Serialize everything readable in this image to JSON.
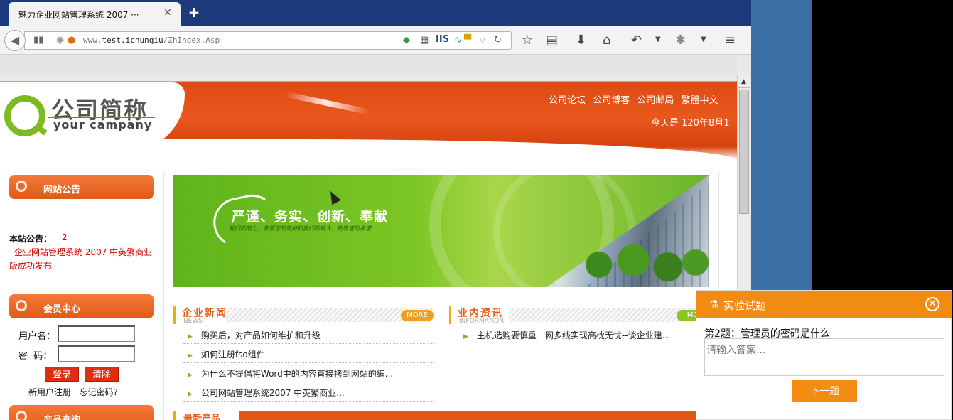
{
  "browser": {
    "tab_title": "魅力企业网站管理系统 2007 ···",
    "tab_close": "✕",
    "new_tab": "+",
    "url_prefix": "www.",
    "url_host": "test.ichunqiu",
    "url_path": "/ZhIndex.Asp",
    "url_toolbar_text": "IIS"
  },
  "header": {
    "logo_name": "公司简称",
    "logo_en": "your campany",
    "links": [
      "公司论坛",
      "公司博客",
      "公司邮局",
      "繁體中文"
    ],
    "today": "今天是 120年8月1"
  },
  "sidebar": {
    "notice_heading": "网站公告",
    "notice_label": "本站公告：",
    "notice_count": "2",
    "notice_item": "企业网站管理系统 2007 中英繁商业版成功发布",
    "member_heading": "会员中心",
    "username_label": "用户名：",
    "password_label": "密  码：",
    "login_button": "登录",
    "clear_button": "清除",
    "register_link": "新用户注册",
    "forgot_link": "忘记密码?",
    "product_heading": "产品查询"
  },
  "banner": {
    "slogan": "严谨、务实、创新、奉献",
    "sub": "我们的努力，来源您的支持和我们的耕大，更靠谱的承诺!"
  },
  "news": {
    "title": "企业新闻",
    "en": "NEWS",
    "more": "MORE",
    "items": [
      "购买后，对产品如何维护和升级",
      "如何注册fso组件",
      "为什么不提倡将Word中的内容直接拷到网站的编...",
      "公司网站管理系统2007 中英繁商业..."
    ]
  },
  "industry": {
    "title": "业内资讯",
    "en": "INFORMATION",
    "more": "MO",
    "items": [
      "主机选购要慎重一网多线实现高枕无忧--谈企业建..."
    ]
  },
  "latest": {
    "title": "最新产品"
  },
  "exam": {
    "title": "实验试题",
    "question": "第2题：管理员的密码是什么",
    "placeholder": "请输入答案...",
    "next_button": "下一题"
  },
  "colors": {
    "accent_orange": "#e8581c",
    "exam_orange": "#f28b12",
    "banner_green": "#7cc624",
    "tabbar_blue": "#1c3a7a"
  }
}
